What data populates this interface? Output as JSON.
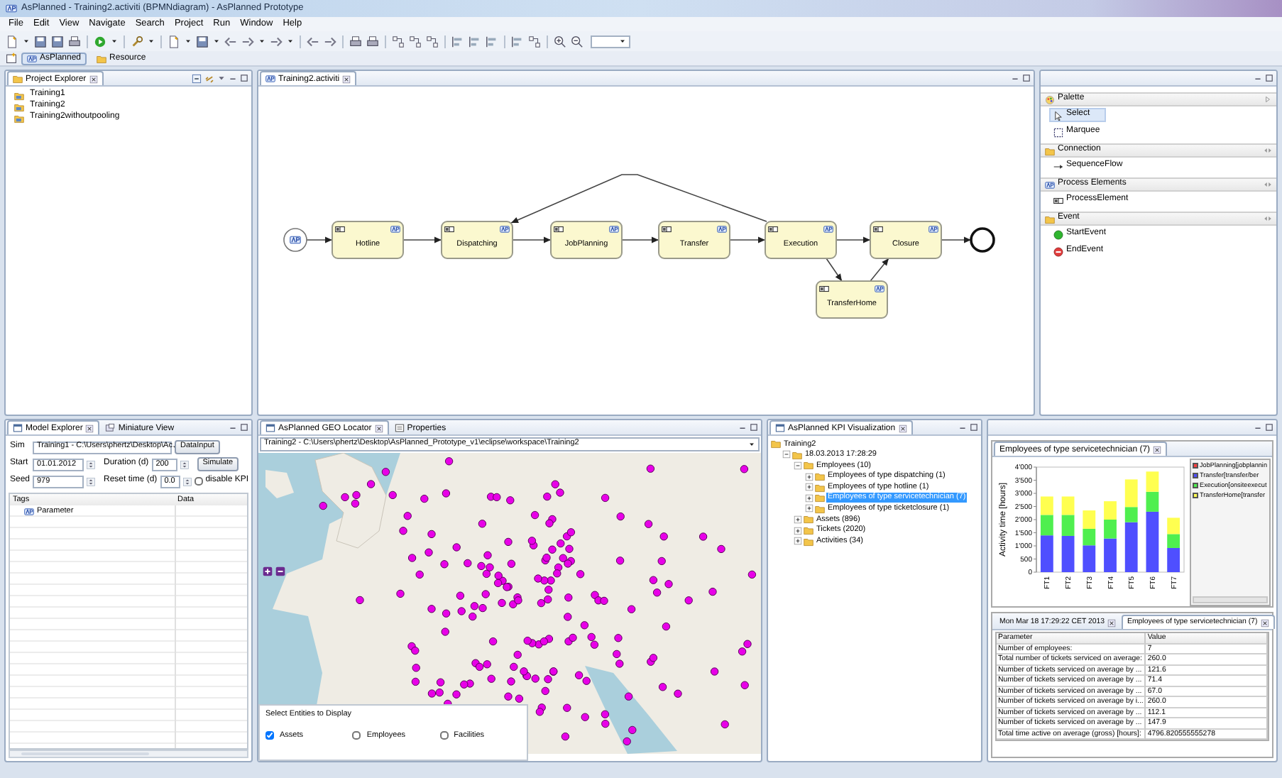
{
  "window": {
    "title": "AsPlanned - Training2.activiti (BPMNdiagram) - AsPlanned Prototype"
  },
  "menu": [
    "File",
    "Edit",
    "View",
    "Navigate",
    "Search",
    "Project",
    "Run",
    "Window",
    "Help"
  ],
  "perspectives": [
    {
      "label": "AsPlanned",
      "selected": true
    },
    {
      "label": "Resource",
      "selected": false
    }
  ],
  "project_explorer": {
    "title": "Project Explorer",
    "items": [
      "Training1",
      "Training2",
      "Training2withoutpooling"
    ]
  },
  "editor": {
    "tab": "Training2.activiti",
    "tasks": [
      "Hotline",
      "Dispatching",
      "JobPlanning",
      "Transfer",
      "Execution",
      "Closure",
      "TransferHome"
    ]
  },
  "palette": {
    "title": "Palette",
    "tools": [
      {
        "label": "Select",
        "kind": "select",
        "selected": true
      },
      {
        "label": "Marquee",
        "kind": "marquee",
        "selected": false
      }
    ],
    "groups": [
      {
        "title": "Connection",
        "kind": "folder",
        "items": [
          {
            "label": "SequenceFlow",
            "kind": "flow"
          }
        ]
      },
      {
        "title": "Process Elements",
        "kind": "ap",
        "items": [
          {
            "label": "ProcessElement",
            "kind": "task"
          }
        ]
      },
      {
        "title": "Event",
        "kind": "folder",
        "items": [
          {
            "label": "StartEvent",
            "kind": "start"
          },
          {
            "label": "EndEvent",
            "kind": "end"
          }
        ]
      }
    ]
  },
  "model_explorer": {
    "tabs": [
      {
        "label": "Model Explorer",
        "selected": true
      },
      {
        "label": "Miniature View",
        "selected": false
      }
    ],
    "sim_label": "Sim",
    "sim_value": "Training1 - C:\\Users\\phertz\\Desktop\\Ac",
    "data_input_button": "DataInput",
    "start_label": "Start",
    "start_value": "01.01.2012",
    "duration_label": "Duration (d)",
    "duration_value": "200",
    "simulate_button": "Simulate",
    "seed_label": "Seed",
    "seed_value": "979",
    "reset_label": "Reset time (d)",
    "reset_value": "0.0",
    "disable_kpi": {
      "label": "disable KPI",
      "checked": false
    },
    "columns": [
      "Tags",
      "Data"
    ],
    "rows": [
      "Parameter"
    ]
  },
  "geo_locator": {
    "tabs": [
      {
        "label": "AsPlanned GEO Locator",
        "selected": true
      },
      {
        "label": "Properties",
        "selected": false
      }
    ],
    "path": "Training2 - C:\\Users\\phertz\\Desktop\\AsPlanned_Prototype_v1\\eclipse\\workspace\\Training2",
    "entities_title": "Select Entities to Display",
    "entities": [
      {
        "label": "Assets",
        "checked": true
      },
      {
        "label": "Employees",
        "checked": false
      },
      {
        "label": "Facilities",
        "checked": false
      }
    ]
  },
  "kpi_tree": {
    "title": "AsPlanned KPI Visualization",
    "nodes": [
      {
        "label": "Training2",
        "selected": false,
        "children": [
          {
            "label": "18.03.2013 17:28:29",
            "expanded": true,
            "selected": false,
            "children": [
              {
                "label": "Employees (10)",
                "expanded": true,
                "selected": false,
                "children": [
                  {
                    "label": "Employees of type dispatching (1)",
                    "expanded": false,
                    "selected": false
                  },
                  {
                    "label": "Employees of type hotline (1)",
                    "expanded": false,
                    "selected": false
                  },
                  {
                    "label": "Employees of type servicetechnician (7)",
                    "expanded": false,
                    "selected": true
                  },
                  {
                    "label": "Employees of type ticketclosure (1)",
                    "expanded": false,
                    "selected": false
                  }
                ]
              },
              {
                "label": "Assets (896)",
                "expanded": false,
                "selected": false
              },
              {
                "label": "Tickets (2020)",
                "expanded": false,
                "selected": false
              },
              {
                "label": "Activities (34)",
                "expanded": false,
                "selected": false
              }
            ]
          }
        ]
      }
    ]
  },
  "kpi_chart": {
    "tab": "Employees of type servicetechnician (7)",
    "chart_data": {
      "type": "bar",
      "stacked": true,
      "ylabel": "Activity time [hours]",
      "categories": [
        "FT1",
        "FT2",
        "FT3",
        "FT4",
        "FT5",
        "FT6",
        "FT7"
      ],
      "series": [
        {
          "name": "JobPlanning[jobplannin",
          "color": "#ff4040",
          "values": [
            0,
            0,
            0,
            0,
            0,
            0,
            0
          ]
        },
        {
          "name": "Transfer[transfer/ber",
          "color": "#4f4fff",
          "values": [
            1400,
            1380,
            1020,
            1280,
            1900,
            2300,
            920
          ]
        },
        {
          "name": "Execution[onsiteexecut",
          "color": "#4fef4f",
          "values": [
            780,
            800,
            630,
            720,
            580,
            760,
            530
          ]
        },
        {
          "name": "TransferHome[transfer",
          "color": "#ffff50",
          "values": [
            700,
            700,
            700,
            700,
            1050,
            770,
            620
          ]
        }
      ],
      "ylim": [
        0,
        4000
      ],
      "yticks": [
        0,
        500,
        {
          "value": 1000,
          "label": "1'000"
        },
        {
          "value": 1500,
          "label": "1'500"
        },
        {
          "value": 2000,
          "label": "2'000"
        },
        {
          "value": 2500,
          "label": "2'500"
        },
        {
          "value": 3000,
          "label": "3'000"
        },
        {
          "value": 3500,
          "label": "3'500"
        },
        {
          "value": 4000,
          "label": "4'000"
        }
      ]
    }
  },
  "kpi_details": {
    "tabs": [
      {
        "label": "Mon Mar 18 17:29:22 CET 2013",
        "selected": false
      },
      {
        "label": "Employees of type servicetechnician (7)",
        "selected": true
      }
    ],
    "columns": [
      "Parameter",
      "Value"
    ],
    "rows": [
      [
        "Number of employees:",
        "7"
      ],
      [
        "Total number of tickets serviced on average:",
        "260.0"
      ],
      [
        "Number of tickets serviced on average by ...",
        "121.6"
      ],
      [
        "Number of tickets serviced on average by ...",
        "71.4"
      ],
      [
        "Number of tickets serviced on average by ...",
        "67.0"
      ],
      [
        "Number of tickets serviced on average by i...",
        "260.0"
      ],
      [
        "Number of tickets serviced on average by ...",
        "112.1"
      ],
      [
        "Number of tickets serviced on average by ...",
        "147.9"
      ],
      [
        "Total time active on average (gross) [hours]:",
        "4796.820555555278"
      ]
    ]
  }
}
